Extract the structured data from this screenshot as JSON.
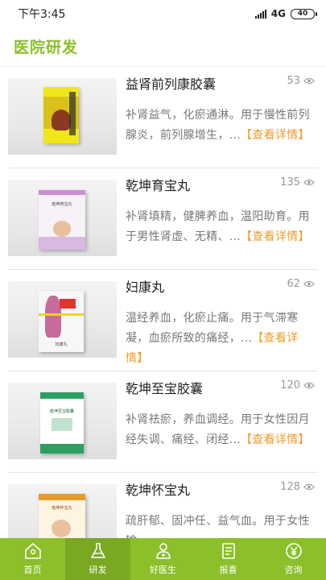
{
  "status": {
    "time": "下午3:45",
    "network": "4G",
    "battery": "40"
  },
  "header": {
    "title": "医院研发"
  },
  "products": [
    {
      "name": "益肾前列康胶囊",
      "views": "53",
      "desc": "补肾益气，化瘀通淋。用于慢性前列腺炎，前列腺增生，...",
      "more": "【查看详情】"
    },
    {
      "name": "乾坤育宝丸",
      "views": "135",
      "desc": "补肾填精，健脾养血，温阳助育。用于男性肾虚、无精、...",
      "more": "【查看详情】"
    },
    {
      "name": "妇康丸",
      "views": "62",
      "desc": "温经养血，化瘀止痛。用于气滞寒凝，血瘀所致的痛经，...",
      "more": "【查看详情】"
    },
    {
      "name": "乾坤至宝胶囊",
      "views": "120",
      "desc": "补肾祛瘀，养血调经。用于女性因月经失调、痛经、闭经...",
      "more": "【查看详情】"
    },
    {
      "name": "乾坤怀宝丸",
      "views": "128",
      "desc": "疏肝郁、固冲任、益气血。用于女性输",
      "more": ""
    }
  ],
  "tabs": [
    {
      "label": "首页",
      "icon": "home-location-icon"
    },
    {
      "label": "研发",
      "icon": "flask-icon"
    },
    {
      "label": "好医生",
      "icon": "doctor-icon"
    },
    {
      "label": "报喜",
      "icon": "report-icon"
    },
    {
      "label": "咨询",
      "icon": "yen-coin-icon"
    }
  ],
  "colors": {
    "brand": "#8cbf2a",
    "link": "#ee9b2a",
    "text_muted": "#777777"
  }
}
